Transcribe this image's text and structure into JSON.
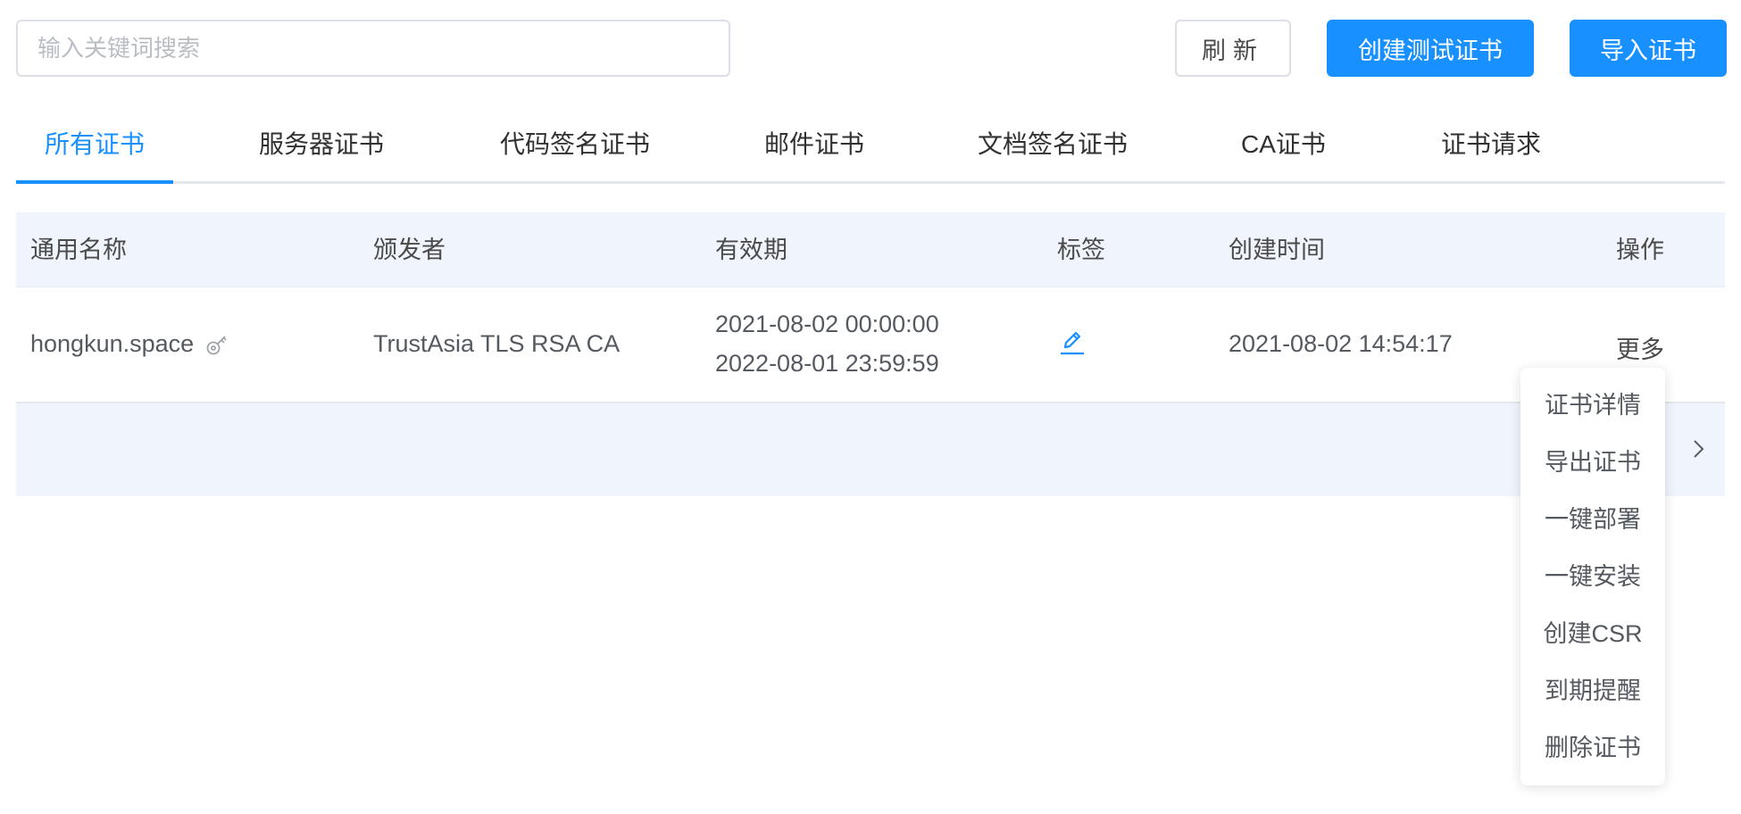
{
  "search": {
    "placeholder": "输入关键词搜索",
    "value": ""
  },
  "toolbar": {
    "refresh_label": "刷新",
    "create_test_cert_label": "创建测试证书",
    "import_cert_label": "导入证书"
  },
  "tabs": [
    {
      "label": "所有证书",
      "active": true
    },
    {
      "label": "服务器证书",
      "active": false
    },
    {
      "label": "代码签名证书",
      "active": false
    },
    {
      "label": "邮件证书",
      "active": false
    },
    {
      "label": "文档签名证书",
      "active": false
    },
    {
      "label": "CA证书",
      "active": false
    },
    {
      "label": "证书请求",
      "active": false
    }
  ],
  "table": {
    "columns": [
      "通用名称",
      "颁发者",
      "有效期",
      "标签",
      "创建时间",
      "操作"
    ],
    "rows": [
      {
        "common_name": "hongkun.space",
        "issuer": "TrustAsia TLS RSA CA",
        "valid_from": "2021-08-02 00:00:00",
        "valid_to": "2022-08-01 23:59:59",
        "created_at": "2021-08-02 14:54:17",
        "action_label": "更多"
      }
    ]
  },
  "dropdown": {
    "items": [
      "证书详情",
      "导出证书",
      "一键部署",
      "一键安装",
      "创建CSR",
      "到期提醒",
      "删除证书"
    ]
  },
  "icons": {
    "key": "key-icon",
    "edit": "edit-pencil-icon",
    "chevron": "chevron-right-icon"
  },
  "colors": {
    "primary": "#1890ff",
    "header_bg": "#f0f4fc",
    "text": "#555a61"
  }
}
